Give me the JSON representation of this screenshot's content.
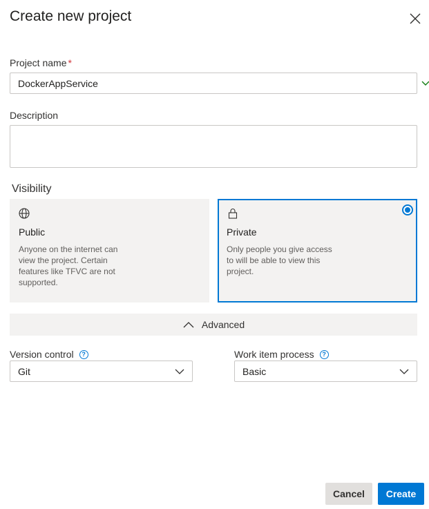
{
  "dialog": {
    "title": "Create new project",
    "close_icon": "close-icon"
  },
  "project_name": {
    "label": "Project name",
    "required_mark": "*",
    "value": "DockerAppService",
    "valid_icon": "checkmark-icon"
  },
  "description": {
    "label": "Description",
    "value": ""
  },
  "visibility": {
    "label": "Visibility",
    "selected": "Private",
    "options": [
      {
        "icon": "globe-icon",
        "title": "Public",
        "description": "Anyone on the internet can view the project. Certain features like TFVC are not supported."
      },
      {
        "icon": "lock-icon",
        "title": "Private",
        "description": "Only people you give access to will be able to view this project."
      }
    ]
  },
  "advanced": {
    "label": "Advanced",
    "icon": "chevron-up-icon"
  },
  "version_control": {
    "label": "Version control",
    "value": "Git"
  },
  "work_item_process": {
    "label": "Work item process",
    "value": "Basic"
  },
  "buttons": {
    "cancel": "Cancel",
    "create": "Create"
  },
  "colors": {
    "accent": "#0078d4",
    "card_background": "#f3f2f1",
    "required": "#d13438",
    "valid": "#107c10"
  }
}
